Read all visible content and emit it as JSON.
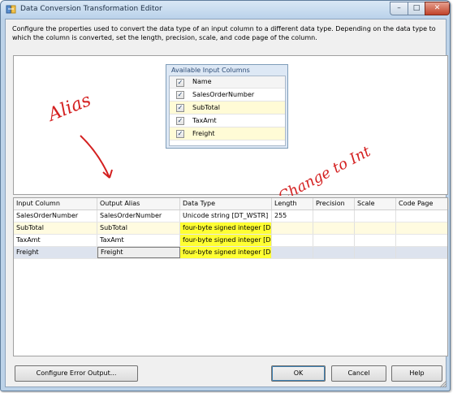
{
  "window": {
    "title": "Data Conversion Transformation Editor",
    "controls": {
      "minimize": "–",
      "maximize": "□",
      "close": "✕"
    }
  },
  "description": "Configure the properties used to convert the data type of an input column to a different data type. Depending on the data type to which the column is converted, set the length, precision, scale, and code page of the column.",
  "available_columns": {
    "title": "Available Input Columns",
    "header": "Name",
    "items": [
      {
        "label": "SalesOrderNumber",
        "checked": true
      },
      {
        "label": "SubTotal",
        "checked": true
      },
      {
        "label": "TaxAmt",
        "checked": true
      },
      {
        "label": "Freight",
        "checked": true
      }
    ]
  },
  "annotations": {
    "alias": "Alias",
    "change": "Change to Int",
    "ink_color": "#d42020"
  },
  "grid": {
    "columns": [
      "Input Column",
      "Output Alias",
      "Data Type",
      "Length",
      "Precision",
      "Scale",
      "Code Page"
    ],
    "rows": [
      [
        "SalesOrderNumber",
        "SalesOrderNumber",
        "Unicode string [DT_WSTR]",
        "255",
        "",
        "",
        ""
      ],
      [
        "SubTotal",
        "SubTotal",
        "four-byte signed integer [D...",
        "",
        "",
        "",
        ""
      ],
      [
        "TaxAmt",
        "TaxAmt",
        "four-byte signed integer [D...",
        "",
        "",
        "",
        ""
      ],
      [
        "Freight",
        "Freight",
        "four-byte signed integer [D...",
        "",
        "",
        "",
        ""
      ]
    ],
    "highlight_color": "#ffff33"
  },
  "buttons": {
    "configure_error_output": "Configure Error Output...",
    "ok": "OK",
    "cancel": "Cancel",
    "help": "Help"
  }
}
